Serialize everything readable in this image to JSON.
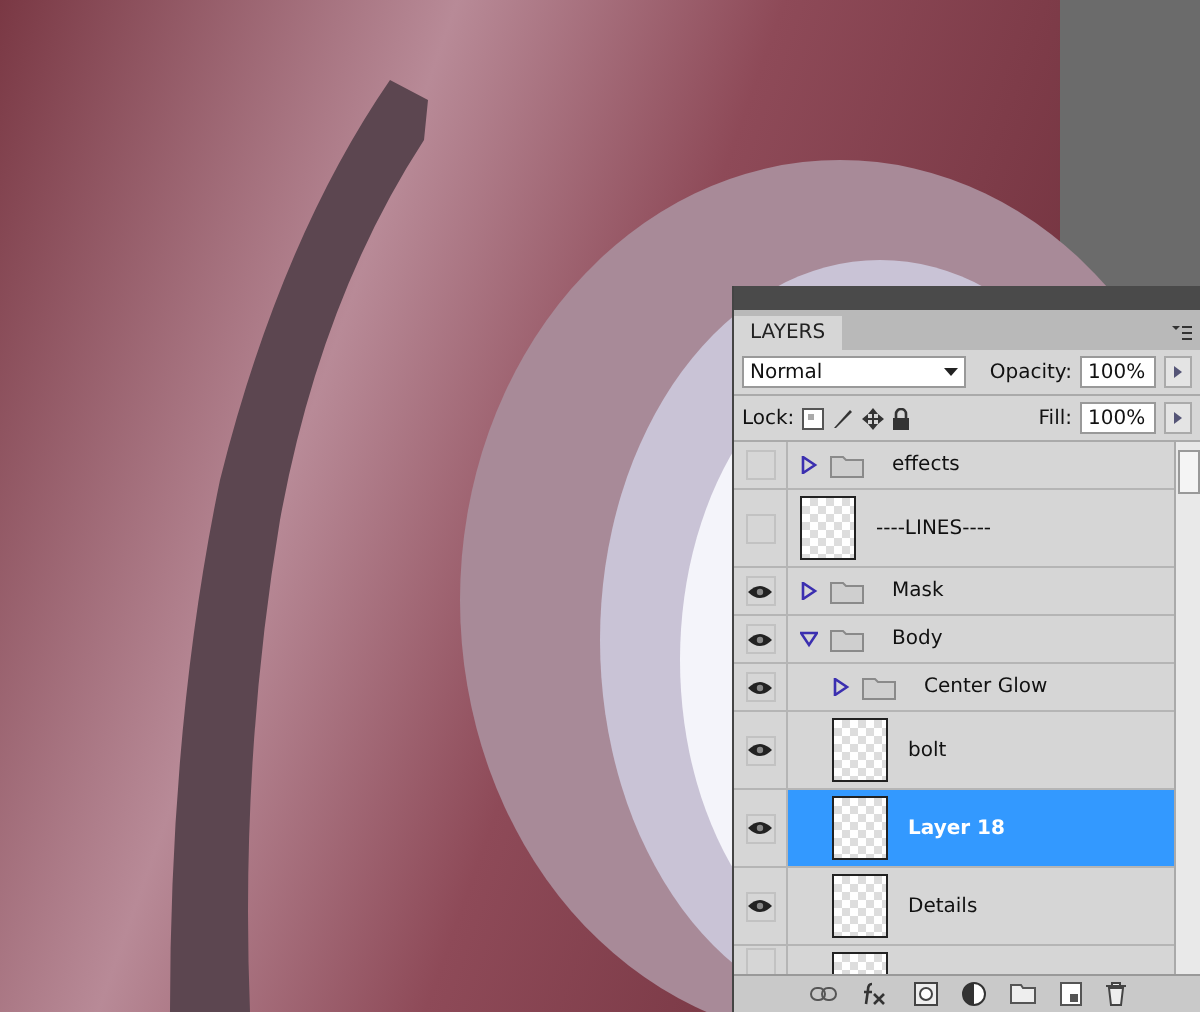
{
  "panel": {
    "tab": "LAYERS",
    "blend_mode": "Normal",
    "opacity_label": "Opacity:",
    "opacity": "100%",
    "lock_label": "Lock:",
    "fill_label": "Fill:",
    "fill": "100%"
  },
  "layers": [
    {
      "kind": "group",
      "name": "effects",
      "visible": false,
      "expanded": false,
      "selected": false
    },
    {
      "kind": "layer",
      "name": "----LINES----",
      "visible": false,
      "selected": false
    },
    {
      "kind": "group",
      "name": "Mask",
      "visible": true,
      "expanded": false,
      "selected": false
    },
    {
      "kind": "group",
      "name": "Body",
      "visible": true,
      "expanded": true,
      "selected": false,
      "children": [
        {
          "kind": "group",
          "name": "Center Glow",
          "visible": true,
          "expanded": false,
          "selected": false
        },
        {
          "kind": "layer",
          "name": "bolt",
          "visible": true,
          "selected": false
        },
        {
          "kind": "layer",
          "name": "Layer 18",
          "visible": true,
          "selected": true
        },
        {
          "kind": "layer",
          "name": "Details",
          "visible": true,
          "selected": false
        },
        {
          "kind": "partial",
          "visible": false,
          "selected": false
        }
      ]
    }
  ]
}
